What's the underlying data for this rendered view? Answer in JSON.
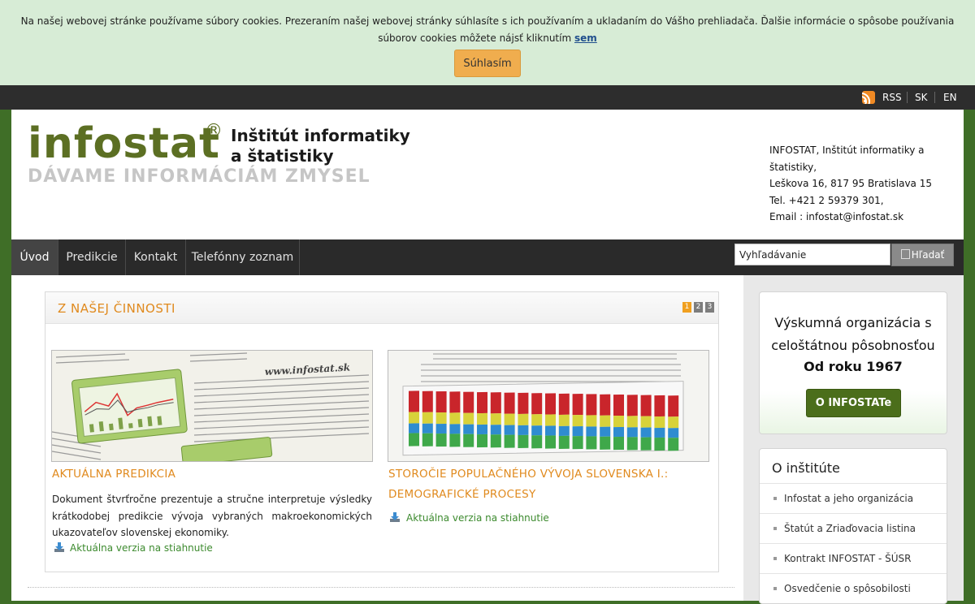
{
  "cookie": {
    "text": "Na našej webovej stránke používame súbory cookies. Prezeraním našej webovej stránky súhlasíte s ich používaním a ukladaním do Vášho prehliadača. Ďalšie informácie o spôsobe používania súborov cookies môžete nájsť kliknutím",
    "link": "sem",
    "button": "Súhlasím"
  },
  "topbar": {
    "rss": "RSS",
    "sk": "SK",
    "en": "EN"
  },
  "header": {
    "logo": "infostat",
    "logo_reg": "®",
    "title_line1": "Inštitút informatiky",
    "title_line2": "a štatistiky",
    "slogan": "DÁVAME INFORMÁCIÁM ZMYSEL",
    "address": [
      "INFOSTAT, Inštitút informatiky a štatistiky,",
      "Leškova 16, 817 95 Bratislava 15",
      "Tel. +421 2 59379 301,",
      "Email : infostat@infostat.sk"
    ]
  },
  "nav": {
    "items": [
      "Úvod",
      "Predikcie",
      "Kontakt",
      "Telefónny zoznam"
    ],
    "search_placeholder": "Vyhľadávanie",
    "search_button": "Hľadať"
  },
  "activities": {
    "title": "Z NAŠEJ ČINNOSTI",
    "pages": [
      "1",
      "2",
      "3"
    ],
    "news": [
      {
        "title": "AKTUÁLNA PREDIKCIA",
        "description": "Dokument štvrťročne prezentuje a stručne interpretuje výsledky krátkodobej predikcie vývoja vybraných makroekonomických ukazovateľov slovenskej ekonomiky.",
        "download": "Aktuálna verzia na stiahnutie"
      },
      {
        "title_line1": "STOROČIE POPULAČNÉHO VÝVOJA SLOVENSKA I.:",
        "title_line2": "DEMOGRAFICKÉ PROCESY",
        "download": "Aktuálna verzia na stiahnutie"
      }
    ],
    "thumb1_url": "www.infostat.sk"
  },
  "sidebar": {
    "promo_line1": "Výskumná organizácia s",
    "promo_line2": "celoštátnou pôsobnosťou",
    "promo_bold": "Od roku 1967",
    "promo_button": "O INFOSTATe",
    "institute_title": "O inštitúte",
    "institute_items": [
      "Infostat a jeho organizácia",
      "Štatút a Zriaďovacia listina",
      "Kontrakt INFOSTAT - ŠÚSR",
      "Osvedčenie o spôsobilosti"
    ]
  },
  "colors": {
    "accent": "#e08a1e",
    "link_green": "#3c8a2e",
    "button_green": "#4b6e1b",
    "cookie_bg": "#d7ecd6"
  }
}
